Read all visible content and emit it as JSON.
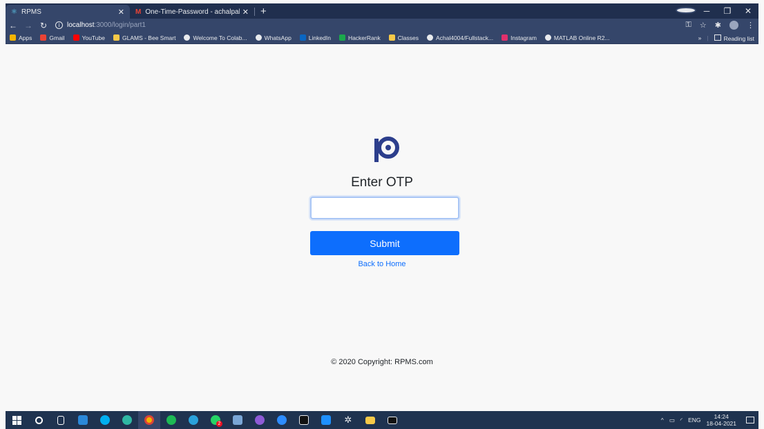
{
  "browser": {
    "tabs": [
      {
        "title": "RPMS",
        "active": true,
        "icon": "react-icon"
      },
      {
        "title": "One-Time-Password - achalpalne",
        "active": false,
        "icon": "gmail-icon"
      }
    ],
    "url_host": "localhost",
    "url_path": ":3000/login/part1",
    "bookmarks": [
      {
        "label": "Apps",
        "icon": "apps-grid-icon",
        "color": "#f4b400"
      },
      {
        "label": "Gmail",
        "icon": "gmail-icon",
        "color": "#ea4335"
      },
      {
        "label": "YouTube",
        "icon": "youtube-icon",
        "color": "#ff0000"
      },
      {
        "label": "GLAMS - Bee Smart",
        "icon": "bee-icon",
        "color": "#f7c948"
      },
      {
        "label": "Welcome To Colab...",
        "icon": "globe-icon",
        "color": "#e8eaed"
      },
      {
        "label": "WhatsApp",
        "icon": "globe-icon",
        "color": "#e8eaed"
      },
      {
        "label": "LinkedIn",
        "icon": "linkedin-icon",
        "color": "#0a66c2"
      },
      {
        "label": "HackerRank",
        "icon": "hackerrank-icon",
        "color": "#1ba94c"
      },
      {
        "label": "Classes",
        "icon": "classroom-icon",
        "color": "#f7c948"
      },
      {
        "label": "Achal4004/Fullstack...",
        "icon": "github-icon",
        "color": "#e8eaed"
      },
      {
        "label": "Instagram",
        "icon": "instagram-icon",
        "color": "#e1306c"
      },
      {
        "label": "MATLAB Online R2...",
        "icon": "globe-icon",
        "color": "#e8eaed"
      }
    ],
    "more_bookmarks": "»",
    "reading_list": "Reading list"
  },
  "page": {
    "heading": "Enter OTP",
    "otp_value": "",
    "submit_label": "Submit",
    "back_link": "Back to Home",
    "footer": "© 2020 Copyright: RPMS.com",
    "accent_color": "#0d6efd",
    "logo_color": "#2c3e8c"
  },
  "taskbar": {
    "apps": [
      {
        "icon": "windows-start-icon",
        "color": "#ffffff"
      },
      {
        "icon": "search-icon",
        "color": "#ffffff"
      },
      {
        "icon": "task-view-icon",
        "color": "#ffffff"
      },
      {
        "icon": "mail-icon",
        "color": "#2b88d8"
      },
      {
        "icon": "skype-icon",
        "color": "#00aff0"
      },
      {
        "icon": "edge-icon",
        "color": "#2fb7a3"
      },
      {
        "icon": "chrome-icon",
        "color": "#f4b400"
      },
      {
        "icon": "spotify-icon",
        "color": "#1db954"
      },
      {
        "icon": "telegram-icon",
        "color": "#2aa1da"
      },
      {
        "icon": "whatsapp-icon",
        "color": "#25d366"
      },
      {
        "icon": "notepad-icon",
        "color": "#7aa6d6"
      },
      {
        "icon": "github-desktop-icon",
        "color": "#8e5bd6"
      },
      {
        "icon": "zoom-icon",
        "color": "#2d8cff"
      },
      {
        "icon": "intellij-icon",
        "color": "#e8eaed"
      },
      {
        "icon": "vscode-icon",
        "color": "#1e90ff"
      },
      {
        "icon": "settings-gear-icon",
        "color": "#e8eaed"
      },
      {
        "icon": "file-explorer-icon",
        "color": "#f7c948"
      },
      {
        "icon": "terminal-icon",
        "color": "#e8eaed"
      }
    ],
    "whatsapp_badge": "2",
    "language": "ENG",
    "time": "14:24",
    "date": "18-04-2021"
  }
}
